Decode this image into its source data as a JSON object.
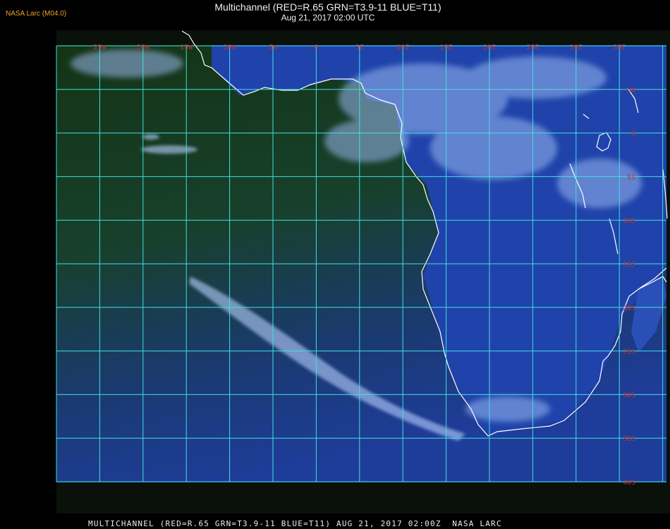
{
  "header": {
    "source_label": "NASA Larc (M04.0)",
    "title_line1": "Multichannel (RED=R.65 GRN=T3.9-11 BLUE=T11)",
    "title_line2": "Aug 21, 2017 02:00 UTC"
  },
  "footer": {
    "text": "MULTICHANNEL (RED=R.65 GRN=T3.9-11 BLUE=T11) AUG 21, 2017 02:00Z  NASA LARC"
  },
  "map": {
    "longitude_labels": [
      "25W",
      "20W",
      "15W",
      "10W",
      "5W",
      "0",
      "5E",
      "10E",
      "15E",
      "20E",
      "25E",
      "30E",
      "35E"
    ],
    "latitude_labels": [
      "5N",
      "0",
      "5S",
      "10S",
      "15S",
      "20S",
      "25S",
      "30S",
      "35S",
      "40S"
    ],
    "colors": {
      "grid": "#40e0e0",
      "grid_label": "#c03030",
      "coastline": "#ffffff",
      "ocean_dark": "#173818",
      "ocean_blue": "#1c3da0",
      "land": "#2448b0",
      "cloud": "#a8c8ff"
    }
  }
}
